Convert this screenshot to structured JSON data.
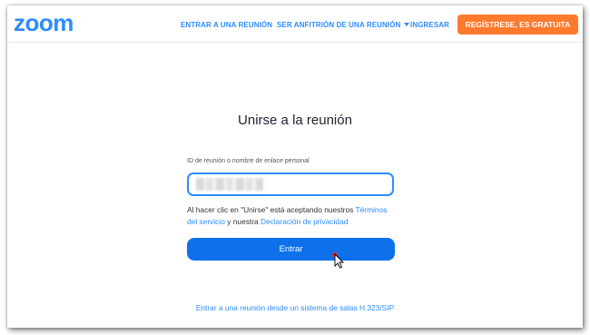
{
  "header": {
    "logo": "zoom",
    "nav": {
      "join": "ENTRAR A UNA REUNIÓN",
      "host": "SER ANFITRIÓN DE UNA REUNIÓN",
      "signin": "INGRESAR"
    },
    "signup_label": "REGÍSTRESE, ES GRATUITA"
  },
  "main": {
    "title": "Unirse a la reunión",
    "field_label": "ID de reunión o nombre de enlace personal",
    "input_value": "",
    "terms_prefix": "Al hacer clic en \"Unirse\" está aceptando nuestros ",
    "terms_link": "Términos del servicio",
    "terms_middle": " y nuestra ",
    "privacy_link": "Declaración de privacidad",
    "join_label": "Entrar",
    "room_system_link": "Entrar a una reunión desde un sistema de salas H.323/SIP"
  },
  "colors": {
    "brand": "#2d8cff",
    "signup": "#ff7a2c",
    "join_button": "#0e71eb"
  },
  "icons": [
    "chevron-down-icon",
    "mouse-cursor-icon"
  ]
}
